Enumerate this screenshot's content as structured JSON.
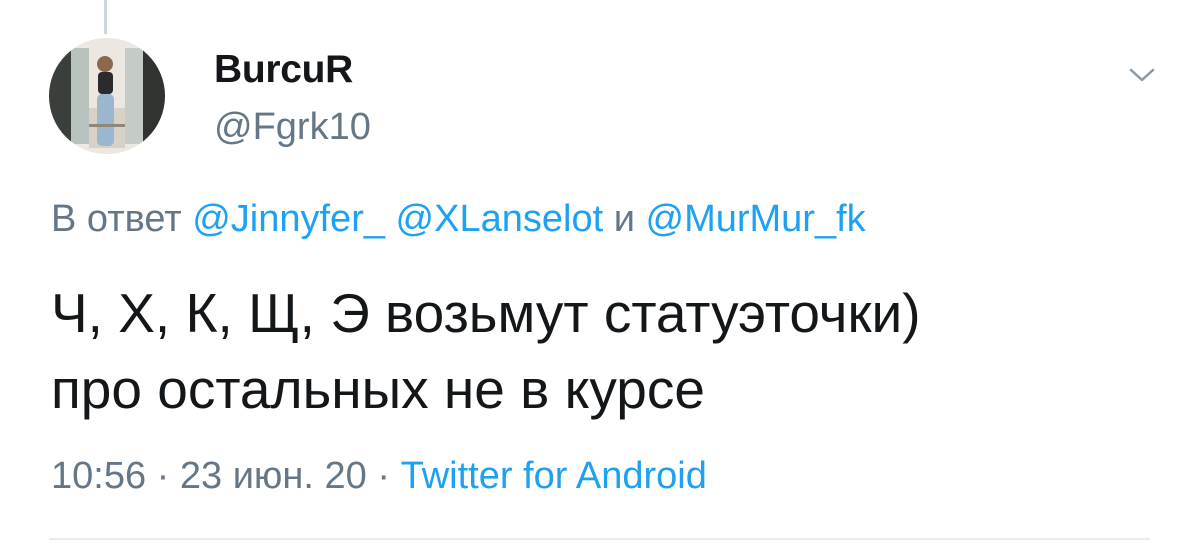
{
  "tweet": {
    "display_name": "BurcuR",
    "handle": "@Fgrk10",
    "reply": {
      "prefix": "В ответ",
      "mentions": [
        "@Jinnyfer_",
        "@XLanselot",
        "@MurMur_fk"
      ],
      "conjunction": "и"
    },
    "text_lines": [
      "Ч, Х, К, Щ, Э возьмут статуэточки)",
      "про остальных не в курсе"
    ],
    "time": "10:56",
    "separator": "·",
    "date": "23 июн. 20",
    "source": "Twitter for Android"
  },
  "icons": {
    "menu": "chevron-down-icon",
    "avatar": "user-avatar"
  },
  "colors": {
    "text": "#14171a",
    "secondary": "#657786",
    "link": "#1da1f2",
    "divider": "#e6ecf0"
  }
}
